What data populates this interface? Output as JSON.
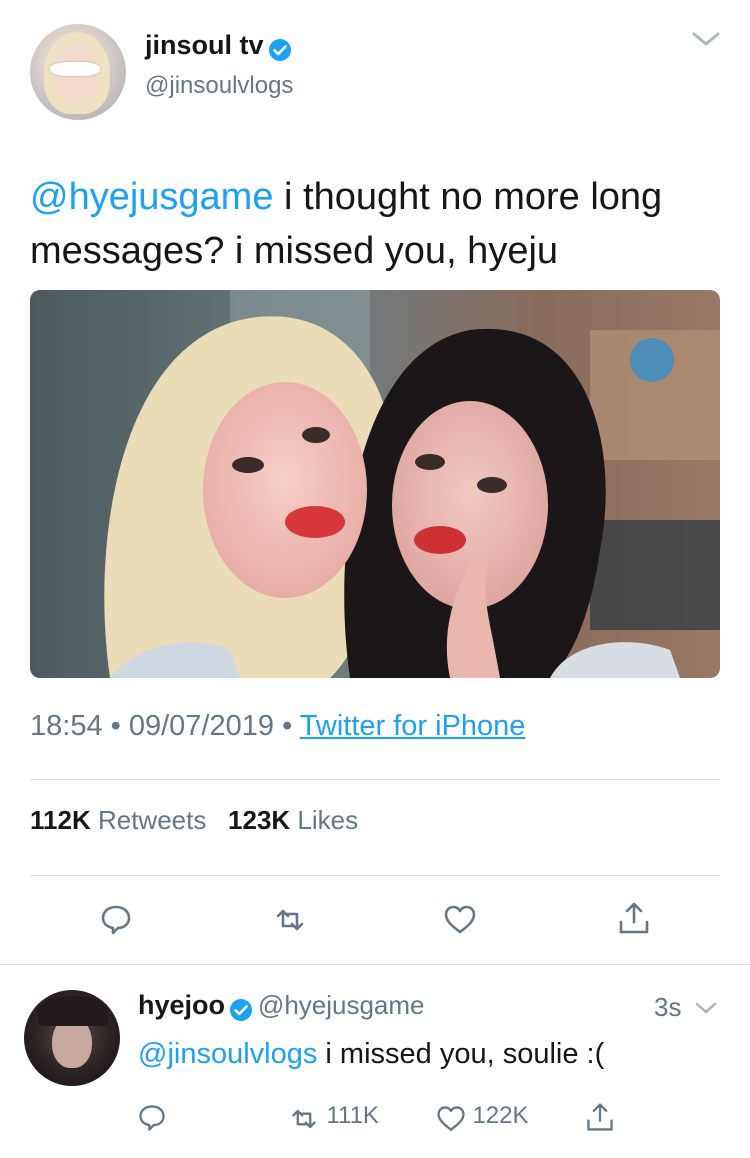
{
  "tweet": {
    "display_name": "jinsoul tv",
    "handle": "@jinsoulvlogs",
    "text_mention": "@hyejusgame",
    "text_body": " i thought no more long messages? i missed you, hyeju",
    "time": "18:54",
    "date": "09/07/2019",
    "source": "Twitter for iPhone",
    "separator": "•",
    "retweets_count": "112K",
    "retweets_label": "Retweets",
    "likes_count": "123K",
    "likes_label": "Likes"
  },
  "reply": {
    "display_name": "hyejoo",
    "handle": "@hyejusgame",
    "timestamp": "3s",
    "text_mention": "@jinsoulvlogs",
    "text_body": " i missed you, soulie :(",
    "retweet_count": "111K",
    "like_count": "122K"
  },
  "icons": [
    "chevron-down-icon",
    "verified-badge-icon",
    "reply-icon",
    "retweet-icon",
    "like-icon",
    "share-icon"
  ],
  "colors": {
    "accent": "#1da1f2",
    "text": "#14171a",
    "muted": "#657786",
    "divider": "#d9dee2"
  }
}
